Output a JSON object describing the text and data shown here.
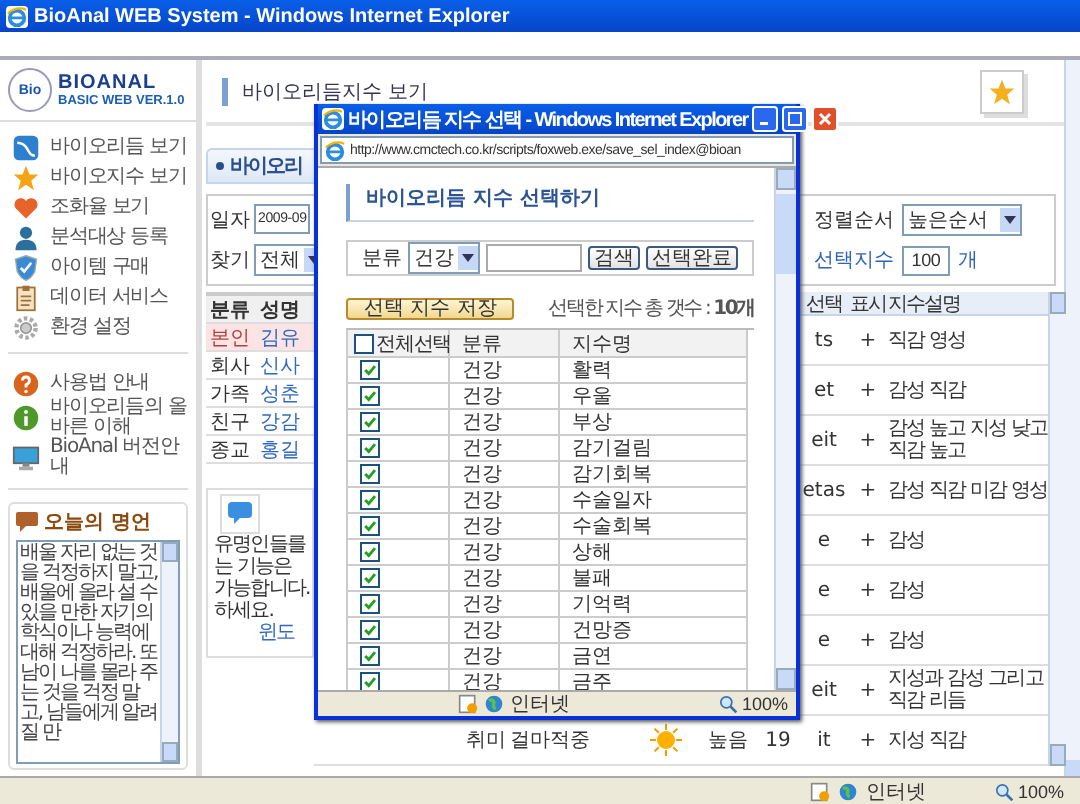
{
  "browser": {
    "title": "BioAnal WEB System - Windows Internet Explorer",
    "status": {
      "zone": "인터넷",
      "zoom": "100%"
    }
  },
  "logo": {
    "badge": "Bio",
    "name": "BIOANAL",
    "subtitle": "BASIC WEB VER.1.0"
  },
  "sidebar": {
    "menu": [
      {
        "label": "바이오리듬 보기",
        "kind": "wave"
      },
      {
        "label": "바이오지수 보기",
        "kind": "star"
      },
      {
        "label": "조화율 보기",
        "kind": "heart"
      },
      {
        "label": "분석대상 등록",
        "kind": "person"
      },
      {
        "label": "아이템 구매",
        "kind": "shield"
      },
      {
        "label": "데이터 서비스",
        "kind": "clipboard"
      },
      {
        "label": "환경 설정",
        "kind": "gear"
      }
    ],
    "help": [
      {
        "label": "사용법 안내",
        "kind": "question"
      },
      {
        "label": "바이오리듬의 올바른 이해",
        "kind": "info"
      },
      {
        "label": "BioAnal 버전안내",
        "kind": "monitor"
      }
    ],
    "quote": {
      "title": "오늘의 명언",
      "text": "배울 자리 없는 것을 걱정하지 말고, 배울에 올라 설 수 있을 만한 자기의 학식이나 능력에 대해 걱정하라. 또 남이 나를 몰라 주는 것을 걱정 말고, 남들에게 알려질 만"
    }
  },
  "page": {
    "title": "바이오리듬지수 보기",
    "tab": "바이오리",
    "filters": {
      "date_label": "일자",
      "date": "2009-09",
      "find_label": "찾기",
      "find": "전체",
      "sort_label": "정렬순서",
      "sort": "높은순서",
      "count_label": "선택지수",
      "count": "100",
      "count_unit": "개"
    },
    "people": {
      "columns": [
        "분류",
        "성명"
      ],
      "rows": [
        {
          "group": "본인",
          "name": "김유",
          "selected": true
        },
        {
          "group": "회사",
          "name": "신사",
          "selected": false
        },
        {
          "group": "가족",
          "name": "성춘",
          "selected": false
        },
        {
          "group": "친구",
          "name": "강감",
          "selected": false
        },
        {
          "group": "종교",
          "name": "홍길",
          "selected": false
        }
      ]
    },
    "notice": {
      "lines": [
        "유명인들를",
        "는 기능은",
        "가능합니다.",
        "하세요."
      ],
      "link": "윈도"
    },
    "index_table": {
      "columns": {
        "code": "선택",
        "mark": "표시",
        "description": "지수설명"
      },
      "rows": [
        {
          "code": "ts",
          "mark": "+",
          "description": "직감 영성"
        },
        {
          "code": "et",
          "mark": "+",
          "description": "감성 직감"
        },
        {
          "code": "eit",
          "mark": "+",
          "description": "감성 높고 지성 낮고 직감 높고"
        },
        {
          "code": "etas",
          "mark": "+",
          "description": "감성 직감 미감 영성"
        },
        {
          "code": "e",
          "mark": "+",
          "description": "감성"
        },
        {
          "code": "e",
          "mark": "+",
          "description": "감성"
        },
        {
          "code": "e",
          "mark": "+",
          "description": "감성"
        },
        {
          "code": "eit",
          "mark": "+",
          "description": "지성과 감성 그리고 직감 리듬"
        },
        {
          "group": "취미",
          "name": "걸마적중",
          "level": "높음",
          "score": "19",
          "code": "it",
          "mark": "+",
          "description": "지성 직감"
        }
      ]
    }
  },
  "popup": {
    "title": "바이오리듬 지수 선택 - Windows Internet Explorer",
    "url": "http://www.cmctech.co.kr/scripts/foxweb.exe/save_sel_index@bioan",
    "heading": "바이오리듬 지수 선택하기",
    "search": {
      "label": "분류",
      "category": "건강",
      "buttons": [
        "검색",
        "선택완료"
      ]
    },
    "save_button": "선택 지수 저장",
    "total": "선택한 지수 총 갯수 : **10개**",
    "columns": [
      "전체선택",
      "분류",
      "지수명"
    ],
    "select_all": false,
    "rows": [
      {
        "checked": true,
        "category": "건강",
        "name": "활력"
      },
      {
        "checked": true,
        "category": "건강",
        "name": "우울"
      },
      {
        "checked": true,
        "category": "건강",
        "name": "부상"
      },
      {
        "checked": true,
        "category": "건강",
        "name": "감기걸림"
      },
      {
        "checked": true,
        "category": "건강",
        "name": "감기회복"
      },
      {
        "checked": true,
        "category": "건강",
        "name": "수술일자"
      },
      {
        "checked": true,
        "category": "건강",
        "name": "수술회복"
      },
      {
        "checked": true,
        "category": "건강",
        "name": "상해"
      },
      {
        "checked": true,
        "category": "건강",
        "name": "불패"
      },
      {
        "checked": true,
        "category": "건강",
        "name": "기억력"
      },
      {
        "checked": true,
        "category": "건강",
        "name": "건망증"
      },
      {
        "checked": true,
        "category": "건강",
        "name": "금연"
      },
      {
        "checked": true,
        "category": "건강",
        "name": "금주"
      }
    ],
    "status": {
      "zone": "인터넷",
      "zoom": "100%"
    }
  }
}
